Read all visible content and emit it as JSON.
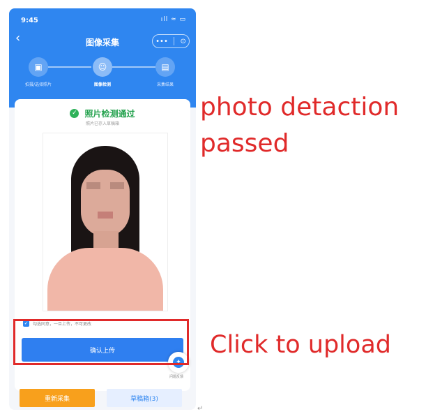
{
  "status_bar": {
    "time": "9:45",
    "icons": "ıll ≈ ▭"
  },
  "nav": {
    "title": "图像采集",
    "more_icon": "•••",
    "target_icon": "⊙",
    "back_icon": "‹"
  },
  "steps": [
    {
      "label": "拍摄/选择照片",
      "icon": "▣"
    },
    {
      "label": "图像检测",
      "icon": "☺"
    },
    {
      "label": "采集结果",
      "icon": "▤"
    }
  ],
  "result": {
    "title": "照片检测通过",
    "subtitle": "照片已存入草稿箱"
  },
  "agreement": {
    "text": "勾选同意，一旦上传，不可更改",
    "checked": true
  },
  "buttons": {
    "confirm_upload": "确认上传",
    "retake": "重新采集",
    "drafts": "草稿箱(3)",
    "float_label": "问题反馈"
  },
  "annotations": {
    "detection": "photo detaction\npassed",
    "upload": "Click to upload"
  },
  "return_mark": "↵",
  "colors": {
    "brand_blue": "#2f86f0",
    "success_green": "#22a14c",
    "retake_orange": "#f8a01c",
    "annotation_red": "#e02a2a"
  }
}
